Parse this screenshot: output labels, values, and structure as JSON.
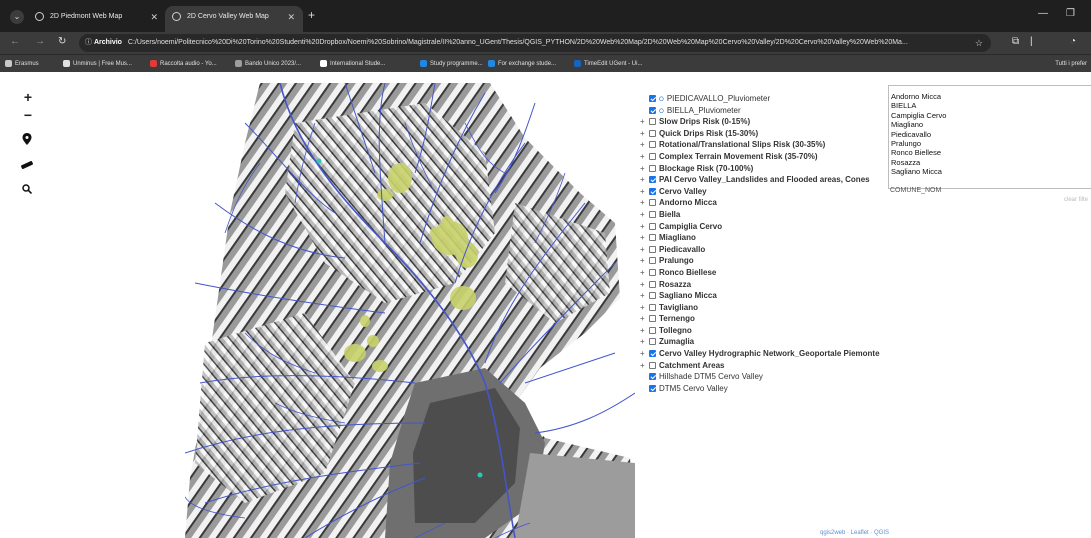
{
  "browser": {
    "tabs": [
      {
        "title": "2D Piedmont Web Map",
        "active": false
      },
      {
        "title": "2D Cervo Valley Web Map",
        "active": true
      }
    ],
    "address": {
      "chip": "Archivio",
      "url": "C:/Users/noemi/Politecnico%20Di%20Torino%20Studenti%20Dropbox/Noemi%20Sobrino/Magistrale/II%20anno_UGent/Thesis/QGIS_PYTHON/2D%20Web%20Map/2D%20Web%20Map%20Cervo%20Valley/2D%20Cervo%20Valley%20Web%20Ma..."
    },
    "bookmarks": [
      {
        "label": "Erasmus",
        "color": "#c9c9c9"
      },
      {
        "label": "Unminus | Free Mus...",
        "color": "#e0e0e0"
      },
      {
        "label": "Raccolta audio - Yo...",
        "color": "#e53935"
      },
      {
        "label": "Bando Unico 2023/...",
        "color": "#9e9e9e"
      },
      {
        "label": "International Stude...",
        "color": "#ffffff"
      },
      {
        "label": "Study programme...",
        "color": "#1e88e5"
      },
      {
        "label": "For exchange stude...",
        "color": "#1e88e5"
      },
      {
        "label": "TimeEdit UGent - Ui...",
        "color": "#1565c0"
      }
    ],
    "bookmarks_right": "Tutti i prefer"
  },
  "map_controls": {
    "zoom_in": "+",
    "zoom_out": "−",
    "icons": [
      "location-pin-icon",
      "ruler-icon",
      "search-icon"
    ]
  },
  "layers": [
    {
      "label": "PIEDICAVALLO_Pluviometer",
      "expander": false,
      "checked": true,
      "pin": true,
      "bold": false
    },
    {
      "label": "BIELLA_Pluviometer",
      "expander": false,
      "checked": true,
      "pin": true,
      "bold": false
    },
    {
      "label": "Slow Drips Risk (0-15%)",
      "expander": true,
      "checked": false,
      "pin": false,
      "bold": true
    },
    {
      "label": "Quick Drips Risk (15-30%)",
      "expander": true,
      "checked": false,
      "pin": false,
      "bold": true
    },
    {
      "label": "Rotational/Translational Slips Risk (30-35%)",
      "expander": true,
      "checked": false,
      "pin": false,
      "bold": true
    },
    {
      "label": "Complex Terrain Movement Risk (35-70%)",
      "expander": true,
      "checked": false,
      "pin": false,
      "bold": true
    },
    {
      "label": "Blockage Risk (70-100%)",
      "expander": true,
      "checked": false,
      "pin": false,
      "bold": true
    },
    {
      "label": "PAI Cervo Valley_Landslides and Flooded areas, Cones",
      "expander": true,
      "checked": true,
      "pin": false,
      "bold": true
    },
    {
      "label": "Cervo Valley",
      "expander": true,
      "checked": true,
      "pin": false,
      "bold": true
    },
    {
      "label": "Andorno Micca",
      "expander": true,
      "checked": false,
      "pin": false,
      "bold": true
    },
    {
      "label": "Biella",
      "expander": true,
      "checked": false,
      "pin": false,
      "bold": true
    },
    {
      "label": "Campiglia Cervo",
      "expander": true,
      "checked": false,
      "pin": false,
      "bold": true
    },
    {
      "label": "Miagliano",
      "expander": true,
      "checked": false,
      "pin": false,
      "bold": true
    },
    {
      "label": "Piedicavallo",
      "expander": true,
      "checked": false,
      "pin": false,
      "bold": true
    },
    {
      "label": "Pralungo",
      "expander": true,
      "checked": false,
      "pin": false,
      "bold": true
    },
    {
      "label": "Ronco Biellese",
      "expander": true,
      "checked": false,
      "pin": false,
      "bold": true
    },
    {
      "label": "Rosazza",
      "expander": true,
      "checked": false,
      "pin": false,
      "bold": true
    },
    {
      "label": "Sagliano Micca",
      "expander": true,
      "checked": false,
      "pin": false,
      "bold": true
    },
    {
      "label": "Tavigliano",
      "expander": true,
      "checked": false,
      "pin": false,
      "bold": true
    },
    {
      "label": "Ternengo",
      "expander": true,
      "checked": false,
      "pin": false,
      "bold": true
    },
    {
      "label": "Tollegno",
      "expander": true,
      "checked": false,
      "pin": false,
      "bold": true
    },
    {
      "label": "Zumaglia",
      "expander": true,
      "checked": false,
      "pin": false,
      "bold": true
    },
    {
      "label": "Cervo Valley Hydrographic Network_Geoportale Piemonte",
      "expander": true,
      "checked": true,
      "pin": false,
      "bold": true
    },
    {
      "label": "Catchment Areas",
      "expander": true,
      "checked": false,
      "pin": false,
      "bold": true
    },
    {
      "label": "Hillshade DTM5 Cervo Valley",
      "expander": false,
      "checked": true,
      "pin": false,
      "bold": false
    },
    {
      "label": "DTM5 Cervo Valley",
      "expander": false,
      "checked": true,
      "pin": false,
      "bold": false
    }
  ],
  "filter": {
    "options": [
      "Andorno Micca",
      "BIELLA",
      "Campiglia Cervo",
      "Miagliano",
      "Piedicavallo",
      "Pralungo",
      "Ronco Biellese",
      "Rosazza",
      "Sagliano Micca"
    ],
    "caption": "COMUNE_NOM",
    "clear_label": "clear filte"
  },
  "attribution": "qgis2web · Leaflet · QGIS",
  "colors": {
    "river": "#4455cc",
    "landslide": "#c8d26a",
    "checkbox": "#1a73e8"
  }
}
